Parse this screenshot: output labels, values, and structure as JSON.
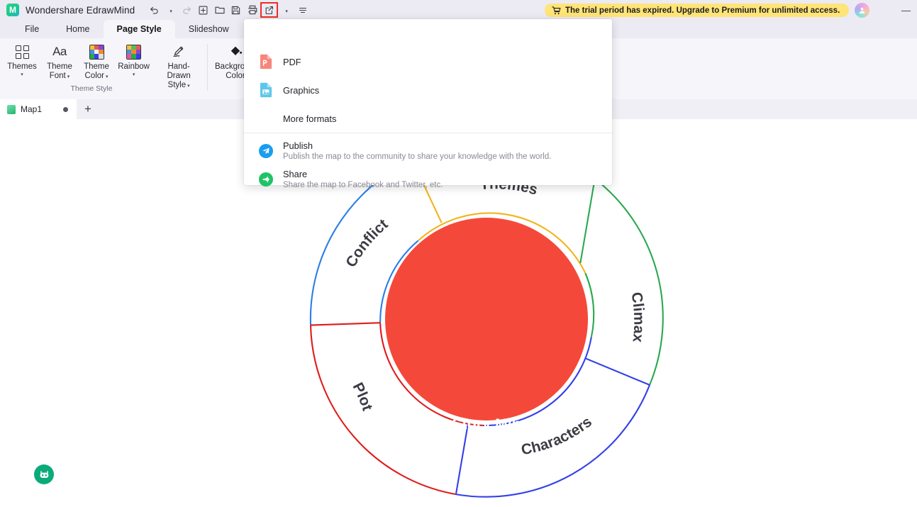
{
  "window": {
    "app_title": "Wondershare EdrawMind",
    "logo_glyph": "M",
    "minimize_label": "—",
    "trial_banner": "The trial period has expired. Upgrade to Premium for unlimited access.",
    "trial_banner_bg": "#ffe477",
    "avatar_name": "user-avatar"
  },
  "quick_toolbar": [
    {
      "name": "undo-button",
      "glyph": "↶",
      "has_caret": true,
      "disabled": false
    },
    {
      "name": "redo-button",
      "glyph": "↷",
      "has_caret": false,
      "disabled": true
    },
    {
      "name": "new-button",
      "glyph": "＋",
      "has_caret": false,
      "disabled": false
    },
    {
      "name": "open-button",
      "glyph": "🗀",
      "has_caret": false,
      "disabled": false
    },
    {
      "name": "save-button",
      "glyph": "🖫",
      "has_caret": false,
      "disabled": false
    },
    {
      "name": "print-button",
      "glyph": "🖨",
      "has_caret": false,
      "disabled": false
    },
    {
      "name": "export-share-button",
      "glyph": "↗",
      "has_caret": true,
      "disabled": false,
      "highlighted": true
    },
    {
      "name": "more-commands-button",
      "glyph": "⌄",
      "has_caret": false,
      "disabled": false
    }
  ],
  "ribbon": {
    "tabs": [
      {
        "label": "File",
        "active": false
      },
      {
        "label": "Home",
        "active": false
      },
      {
        "label": "Page Style",
        "active": true
      },
      {
        "label": "Slideshow",
        "active": false
      }
    ],
    "header_actions": [
      {
        "label": "Publish",
        "icon": "send-icon"
      },
      {
        "label": "Share",
        "icon": "share-nodes-icon"
      }
    ],
    "groups": [
      {
        "caption": "Theme Style",
        "items": [
          {
            "label": "Themes",
            "icon": "themes-grid-icon",
            "caret": true,
            "caret_below": true
          },
          {
            "label": "Theme Font",
            "icon": "font-aa-icon",
            "caret": true,
            "caret_below": false
          },
          {
            "label": "Theme Color",
            "icon": "color-palette-icon",
            "caret": true,
            "caret_below": false
          },
          {
            "label": "Rainbow",
            "icon": "rainbow-grid-icon",
            "caret": true,
            "caret_below": true
          },
          {
            "label": "Hand-Drawn Style",
            "icon": "pencil-icon",
            "caret": true,
            "caret_below": false
          }
        ]
      },
      {
        "caption": "",
        "items": [
          {
            "label": "Background Color",
            "icon": "paint-bucket-icon",
            "caret": false,
            "caret_below": false
          }
        ]
      }
    ]
  },
  "doc_tabs": {
    "tabs": [
      {
        "label": "Map1",
        "modified": true
      }
    ],
    "add_label": "+"
  },
  "export_menu": {
    "items": [
      {
        "name": "pdf",
        "label": "PDF",
        "icon": "pdf-file-icon",
        "color": "#f3655a",
        "desc": ""
      },
      {
        "name": "graphics",
        "label": "Graphics",
        "icon": "image-file-icon",
        "color": "#58bfe8",
        "desc": ""
      },
      {
        "name": "more-formats",
        "label": "More formats",
        "icon": "",
        "color": "",
        "desc": ""
      },
      {
        "name": "publish",
        "label": "Publish",
        "icon": "telegram-send-icon",
        "color": "#1a9cf0",
        "desc": "Publish the map to the community to share your knowledge with the world."
      },
      {
        "name": "share",
        "label": "Share",
        "icon": "share-arrow-icon",
        "color": "#1ec466",
        "desc": "Share the map to Facebook and Twitter, etc."
      }
    ]
  },
  "mindmap": {
    "center_text": "Short Story Mind Map",
    "center_color": "#f4493a",
    "branches": [
      {
        "label": "Themes",
        "color": "#f2b41c"
      },
      {
        "label": "Climax",
        "color": "#2aa84f"
      },
      {
        "label": "Characters",
        "color": "#3340e8"
      },
      {
        "label": "Plot",
        "color": "#e01b1b"
      },
      {
        "label": "Conflict",
        "color": "#2a7ee8"
      }
    ]
  },
  "ai_button": {
    "name": "ai-assistant-button",
    "color": "#0aab78"
  }
}
